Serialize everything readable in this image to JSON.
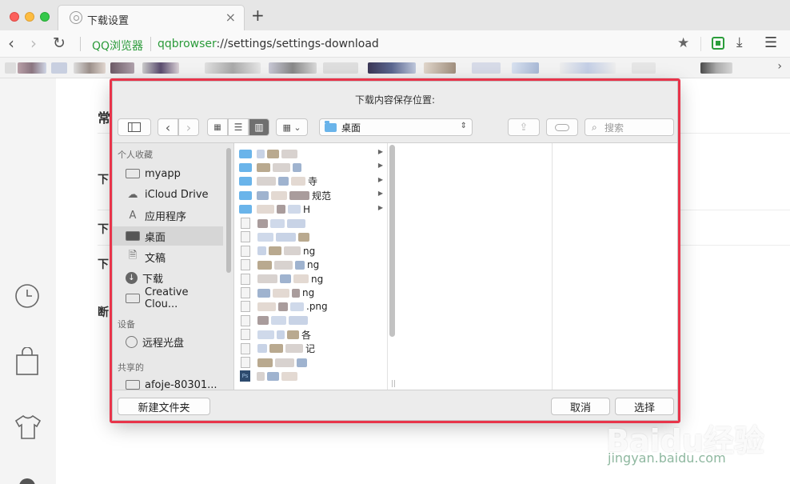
{
  "tab": {
    "title": "下载设置",
    "close": "×",
    "new_tab": "+"
  },
  "toolbar": {
    "brand": "QQ浏览器",
    "url_scheme": "qqbrowser",
    "url_rest": "://settings/settings-download"
  },
  "page_headings": [
    "常",
    "下",
    "下",
    "下",
    "断"
  ],
  "dialog": {
    "title": "下载内容保存位置:",
    "location": "桌面",
    "search_placeholder": "搜索",
    "sidebar": {
      "favorites_header": "个人收藏",
      "favorites": [
        {
          "label": "myapp",
          "icon": "folder-icon"
        },
        {
          "label": "iCloud Drive",
          "icon": "cloud-icon"
        },
        {
          "label": "应用程序",
          "icon": "apps-icon"
        },
        {
          "label": "桌面",
          "icon": "desktop-icon",
          "selected": true
        },
        {
          "label": "文稿",
          "icon": "documents-icon"
        },
        {
          "label": "下载",
          "icon": "download-icon"
        },
        {
          "label": "Creative Clou...",
          "icon": "folder-icon"
        }
      ],
      "devices_header": "设备",
      "devices": [
        {
          "label": "远程光盘",
          "icon": "disc-icon"
        }
      ],
      "shared_header": "共享的",
      "shared": [
        {
          "label": "afoje-80301...",
          "icon": "computer-icon"
        }
      ]
    },
    "files": [
      {
        "kind": "folder",
        "text": ""
      },
      {
        "kind": "folder",
        "text": ""
      },
      {
        "kind": "folder",
        "text": "寺"
      },
      {
        "kind": "folder",
        "text": "规范"
      },
      {
        "kind": "folder",
        "text": "H"
      },
      {
        "kind": "file",
        "text": ""
      },
      {
        "kind": "file",
        "text": ""
      },
      {
        "kind": "file",
        "text": "ng"
      },
      {
        "kind": "file",
        "text": "ng"
      },
      {
        "kind": "file",
        "text": "ng"
      },
      {
        "kind": "file",
        "text": "ng"
      },
      {
        "kind": "file",
        "text": ".png"
      },
      {
        "kind": "file",
        "text": ""
      },
      {
        "kind": "file",
        "text": "各"
      },
      {
        "kind": "file",
        "text": "记"
      },
      {
        "kind": "file",
        "text": ""
      },
      {
        "kind": "ps",
        "text": ""
      }
    ],
    "buttons": {
      "new_folder": "新建文件夹",
      "cancel": "取消",
      "choose": "选择"
    }
  },
  "watermark": {
    "brand": "Baidu经验",
    "url": "jingyan.baidu.com"
  },
  "colors": {
    "brand_green": "#2b9b3a",
    "highlight_red": "#e8344a",
    "folder_blue": "#6ab4ea"
  }
}
